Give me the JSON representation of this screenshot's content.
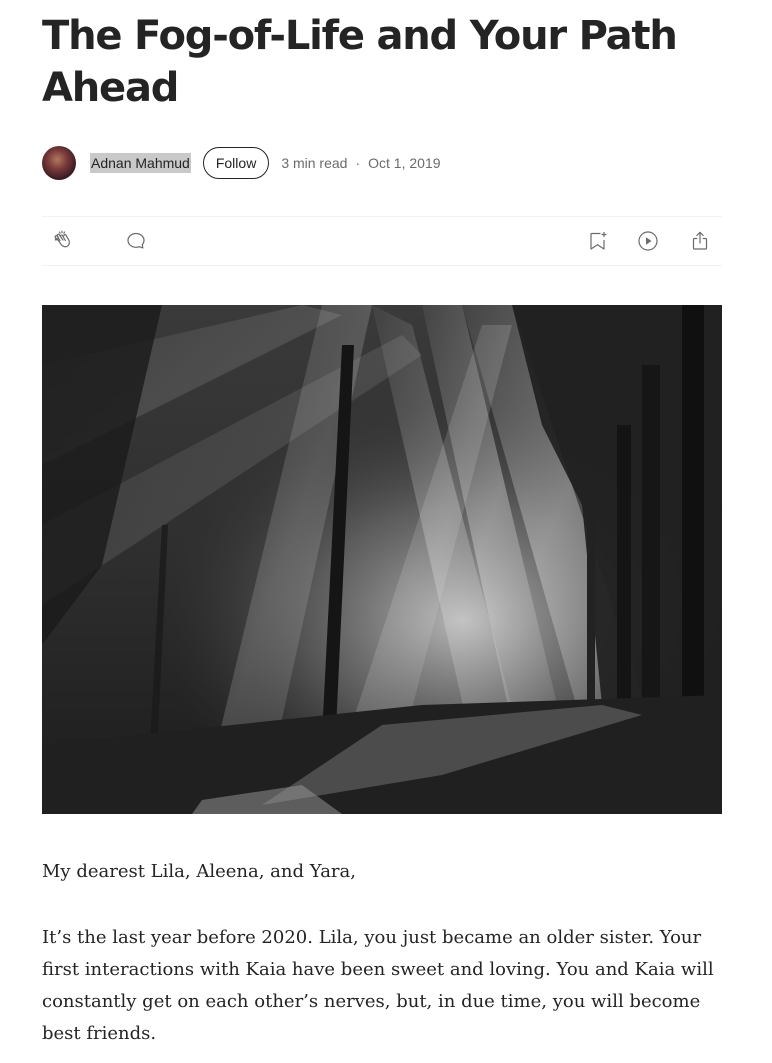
{
  "article": {
    "title": "The Fog-of-Life and Your Path Ahead",
    "author": "Adnan Mahmud",
    "follow_label": "Follow",
    "read_time": "3 min read",
    "separator": "·",
    "date": "Oct 1, 2019"
  },
  "actions": {
    "clap": "clap-icon",
    "response": "comment-icon",
    "save": "bookmark-add-icon",
    "listen": "play-icon",
    "share": "share-icon"
  },
  "body": {
    "paragraphs": [
      "My dearest Lila, Aleena, and Yara,",
      "It’s the last year before 2020. Lila, you just became an older sister. Your first interactions with Kaia have been sweet and loving. You and Kaia will constantly get on each other’s nerves, but, in due time, you will become best friends."
    ]
  }
}
